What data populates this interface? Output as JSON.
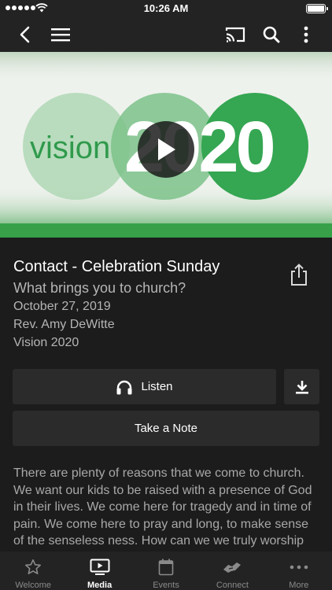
{
  "status_bar": {
    "time": "10:26 AM"
  },
  "nav": {
    "icons": [
      "back-icon",
      "menu-icon",
      "cast-icon",
      "search-icon",
      "more-vertical-icon"
    ]
  },
  "hero": {
    "text_left": "vision",
    "text_year": "2020"
  },
  "media": {
    "title": "Contact - Celebration Sunday",
    "subtitle": "What brings you to church?",
    "date": "October 27, 2019",
    "speaker": "Rev. Amy DeWitte",
    "series": "Vision 2020"
  },
  "actions": {
    "listen_label": "Listen",
    "note_label": "Take a Note"
  },
  "description": "There are plenty of reasons that we come to church. We want our kids to be raised with a presence of God in their lives. We come here for tragedy and in time of pain. We come here to pray and long, to make sense of the senseless ness. How can we we truly worship",
  "tabs": [
    {
      "label": "Welcome",
      "icon": "star-icon",
      "active": false
    },
    {
      "label": "Media",
      "icon": "play-screen-icon",
      "active": true
    },
    {
      "label": "Events",
      "icon": "calendar-icon",
      "active": false
    },
    {
      "label": "Connect",
      "icon": "handshake-icon",
      "active": false
    },
    {
      "label": "More",
      "icon": "more-dots-icon",
      "active": false
    }
  ],
  "colors": {
    "background": "#1c1c1d",
    "bar": "#232324",
    "button": "#2b2b2c",
    "brand_green": "#3aa85a",
    "muted_text": "#b5b5b5"
  }
}
